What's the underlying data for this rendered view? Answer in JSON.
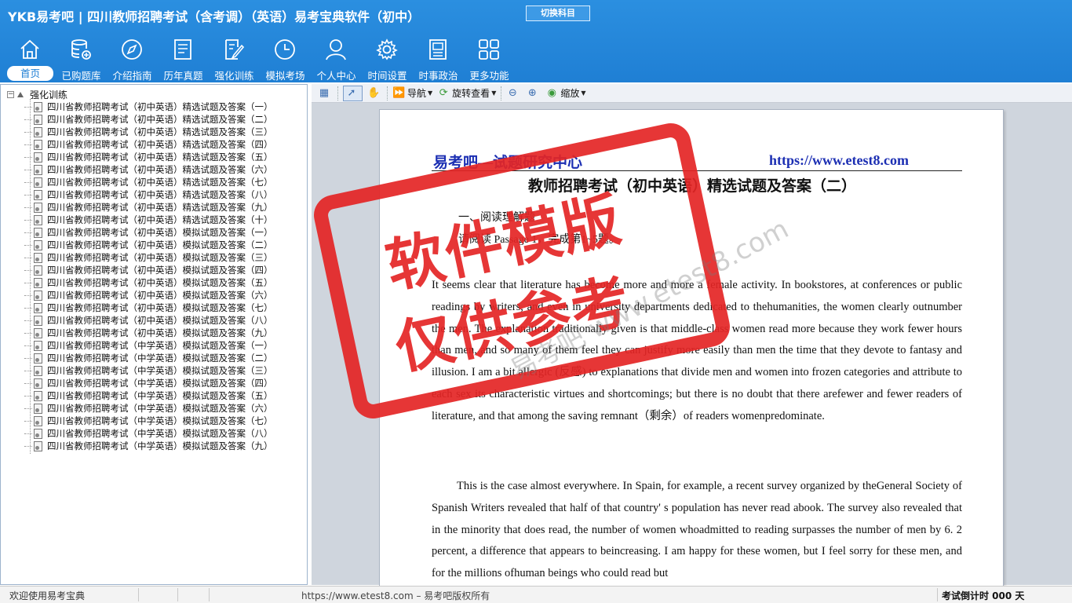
{
  "header": {
    "app_title": "YKB易考吧 | 四川教师招聘考试（含考调）（英语）易考宝典软件（初中）",
    "switch_subject": "切换科目",
    "nav": [
      {
        "label": "首页",
        "icon": "home-icon"
      },
      {
        "label": "已购题库",
        "icon": "database-icon"
      },
      {
        "label": "介绍指南",
        "icon": "compass-icon"
      },
      {
        "label": "历年真题",
        "icon": "list-icon"
      },
      {
        "label": "强化训练",
        "icon": "edit-icon"
      },
      {
        "label": "模拟考场",
        "icon": "clock-icon"
      },
      {
        "label": "个人中心",
        "icon": "user-icon"
      },
      {
        "label": "时间设置",
        "icon": "gear-icon"
      },
      {
        "label": "时事政治",
        "icon": "book-icon"
      },
      {
        "label": "更多功能",
        "icon": "grid-icon"
      }
    ]
  },
  "tree": {
    "root_label": "强化训练",
    "items": [
      "四川省教师招聘考试（初中英语）精选试题及答案（一）",
      "四川省教师招聘考试（初中英语）精选试题及答案（二）",
      "四川省教师招聘考试（初中英语）精选试题及答案（三）",
      "四川省教师招聘考试（初中英语）精选试题及答案（四）",
      "四川省教师招聘考试（初中英语）精选试题及答案（五）",
      "四川省教师招聘考试（初中英语）精选试题及答案（六）",
      "四川省教师招聘考试（初中英语）精选试题及答案（七）",
      "四川省教师招聘考试（初中英语）精选试题及答案（八）",
      "四川省教师招聘考试（初中英语）精选试题及答案（九）",
      "四川省教师招聘考试（初中英语）精选试题及答案（十）",
      "四川省教师招聘考试（初中英语）模拟试题及答案（一）",
      "四川省教师招聘考试（初中英语）模拟试题及答案（二）",
      "四川省教师招聘考试（初中英语）模拟试题及答案（三）",
      "四川省教师招聘考试（初中英语）模拟试题及答案（四）",
      "四川省教师招聘考试（初中英语）模拟试题及答案（五）",
      "四川省教师招聘考试（初中英语）模拟试题及答案（六）",
      "四川省教师招聘考试（初中英语）模拟试题及答案（七）",
      "四川省教师招聘考试（初中英语）模拟试题及答案（八）",
      "四川省教师招聘考试（初中英语）模拟试题及答案（九）",
      "四川省教师招聘考试（中学英语）模拟试题及答案（一）",
      "四川省教师招聘考试（中学英语）模拟试题及答案（二）",
      "四川省教师招聘考试（中学英语）模拟试题及答案（三）",
      "四川省教师招聘考试（中学英语）模拟试题及答案（四）",
      "四川省教师招聘考试（中学英语）模拟试题及答案（五）",
      "四川省教师招聘考试（中学英语）模拟试题及答案（六）",
      "四川省教师招聘考试（中学英语）模拟试题及答案（七）",
      "四川省教师招聘考试（中学英语）模拟试题及答案（八）",
      "四川省教师招聘考试（中学英语）模拟试题及答案（九）"
    ]
  },
  "toolbar": {
    "navigate": "导航",
    "rotate": "旋转查看",
    "zoom": "缩放"
  },
  "document": {
    "brand_left": "易考吧—试题研究中心",
    "brand_right": "https://www.etest8.com",
    "title": "教师招聘考试（初中英语）精选试题及答案（二）",
    "section": "一、阅读理解题",
    "instruction": "请阅读 Passage 1，完成第1~5题。",
    "para1": "It seems clear that literature has become more and more a female activity. In bookstores, at conferences or public readings by writers, and even in university departments dedicated to thehumanities, the women clearly outnumber the men. The explanation traditionally given is that middle-class women read more because they work fewer hours than men, and so many of them feel they can justify more easily than men the time that they devote to fantasy and illusion. I am a bit allergic (反感) to explanations that divide men and women into frozen categories and attribute to each sex its characteristic virtues and shortcomings; but there is no doubt that there arefewer and fewer readers of literature, and that among the saving remnant（剩余）of readers womenpredominate.",
    "para2": "This is the case almost everywhere. In Spain, for example, a recent survey organized by theGeneral Society of Spanish Writers revealed that half of that country' s population has never read abook. The survey also revealed that in the minority that does read, the number of women whoadmitted to reading surpasses the number of men by 6. 2 percent, a difference that appears to beincreasing. I am happy for these women, but I feel sorry for these men, and for the millions ofhuman beings who could read but"
  },
  "watermark": {
    "stamp_line1": "软件模版",
    "stamp_line2": "仅供参考",
    "diagonal": "易考吧 www.etest8.com"
  },
  "status": {
    "welcome": "欢迎使用易考宝典",
    "copyright": "https://www.etest8.com – 易考吧版权所有",
    "countdown": "考试倒计时 000 天"
  },
  "colors": {
    "header_blue": "#1f7fd4",
    "brand_blue": "#1c2fb3",
    "stamp_red": "#e42525"
  }
}
